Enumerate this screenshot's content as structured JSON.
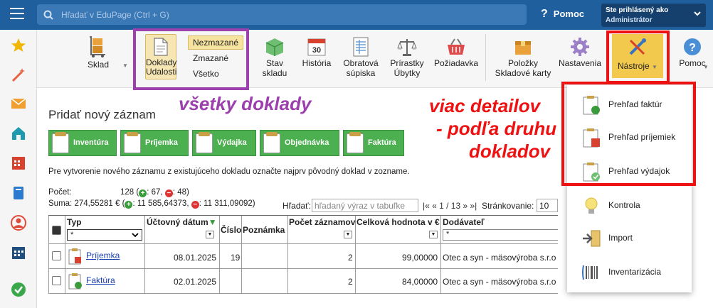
{
  "topbar": {
    "search_placeholder": "Hľadať v EduPage (Ctrl + G)",
    "help_label": "Pomoc",
    "user_line1": "Ste prihlásený ako",
    "user_line2": "Administrátor"
  },
  "toolbar": {
    "sklad": "Sklad",
    "doklady_l1": "Doklady",
    "doklady_l2": "Udalosti",
    "filter_nezmazane": "Nezmazané",
    "filter_zmazane": "Zmazané",
    "filter_vsetko": "Všetko",
    "stav_l1": "Stav",
    "stav_l2": "skladu",
    "historia": "História",
    "obratova_l1": "Obratová",
    "obratova_l2": "súpiska",
    "prirastky_l1": "Prírastky",
    "prirastky_l2": "Úbytky",
    "poziadavka": "Požiadavka",
    "polozky_l1": "Položky",
    "polozky_l2": "Skladové karty",
    "nastavenia": "Nastavenia",
    "nastroje": "Nástroje",
    "pomoc": "Pomoc",
    "calendar_day": "30"
  },
  "annotations": {
    "purple": "všetky doklady",
    "red_l1": "viac detailov",
    "red_l2": "- podľa druhu",
    "red_l3": "dokladov"
  },
  "content": {
    "title": "Pridať nový záznam",
    "buttons": [
      "Inventúra",
      "Príjemka",
      "Výdajka",
      "Objednávka",
      "Faktúra"
    ],
    "hint": "Pre vytvorenie nového záznamu z existujúceho dokladu označte najprv pôvodný doklad v zozname.",
    "count_label": "Počet:",
    "count_value": "128 (",
    "count_plus": "+",
    "count_plus_value": ": 67,",
    "count_minus": "−",
    "count_minus_value": ": 48)",
    "sum_label": "Suma:",
    "sum_value": "274,55281 € (",
    "sum_plus_value": ": 11 585,64373,",
    "sum_minus_value": ": 11 311,09092)",
    "find_label": "Hľadať:",
    "find_placeholder": "hľadaný výraz v tabuľke",
    "pager": "|« « 1 / 13 » »|",
    "page_size_label": "Stránkovanie:",
    "page_size_value": "10"
  },
  "table": {
    "headers": {
      "typ": "Typ",
      "datum": "Účtovný dátum",
      "sort_mark": "▼",
      "cislo": "Číslo",
      "poznamka": "Poznámka",
      "pocet": "Počet záznamov",
      "hodnota": "Celková hodnota v €",
      "dodavatel": "Dodávateľ"
    },
    "filter_all": "*",
    "rows": [
      {
        "typ": "Príjemka",
        "datum": "08.01.2025",
        "cislo": "19",
        "pocet": "2",
        "hodnota": "99,00000",
        "dodavatel": "Otec a syn - mäsovýroba s.r.o"
      },
      {
        "typ": "Faktúra",
        "datum": "02.01.2025",
        "cislo": "",
        "pocet": "2",
        "hodnota": "84,00000",
        "dodavatel": "Otec a syn - mäsovýroba s.r.o"
      }
    ]
  },
  "menu": {
    "items": [
      "Prehľad faktúr",
      "Prehľad príjemiek",
      "Prehľad výdajok",
      "Kontrola",
      "Import",
      "Inventarizácia"
    ]
  },
  "colors": {
    "topbar": "#1f5f9e",
    "accent_green": "#4caf50",
    "highlight_yellow": "#f2c94c",
    "annotation_purple": "#9b40ac",
    "annotation_red": "#ee1111"
  }
}
